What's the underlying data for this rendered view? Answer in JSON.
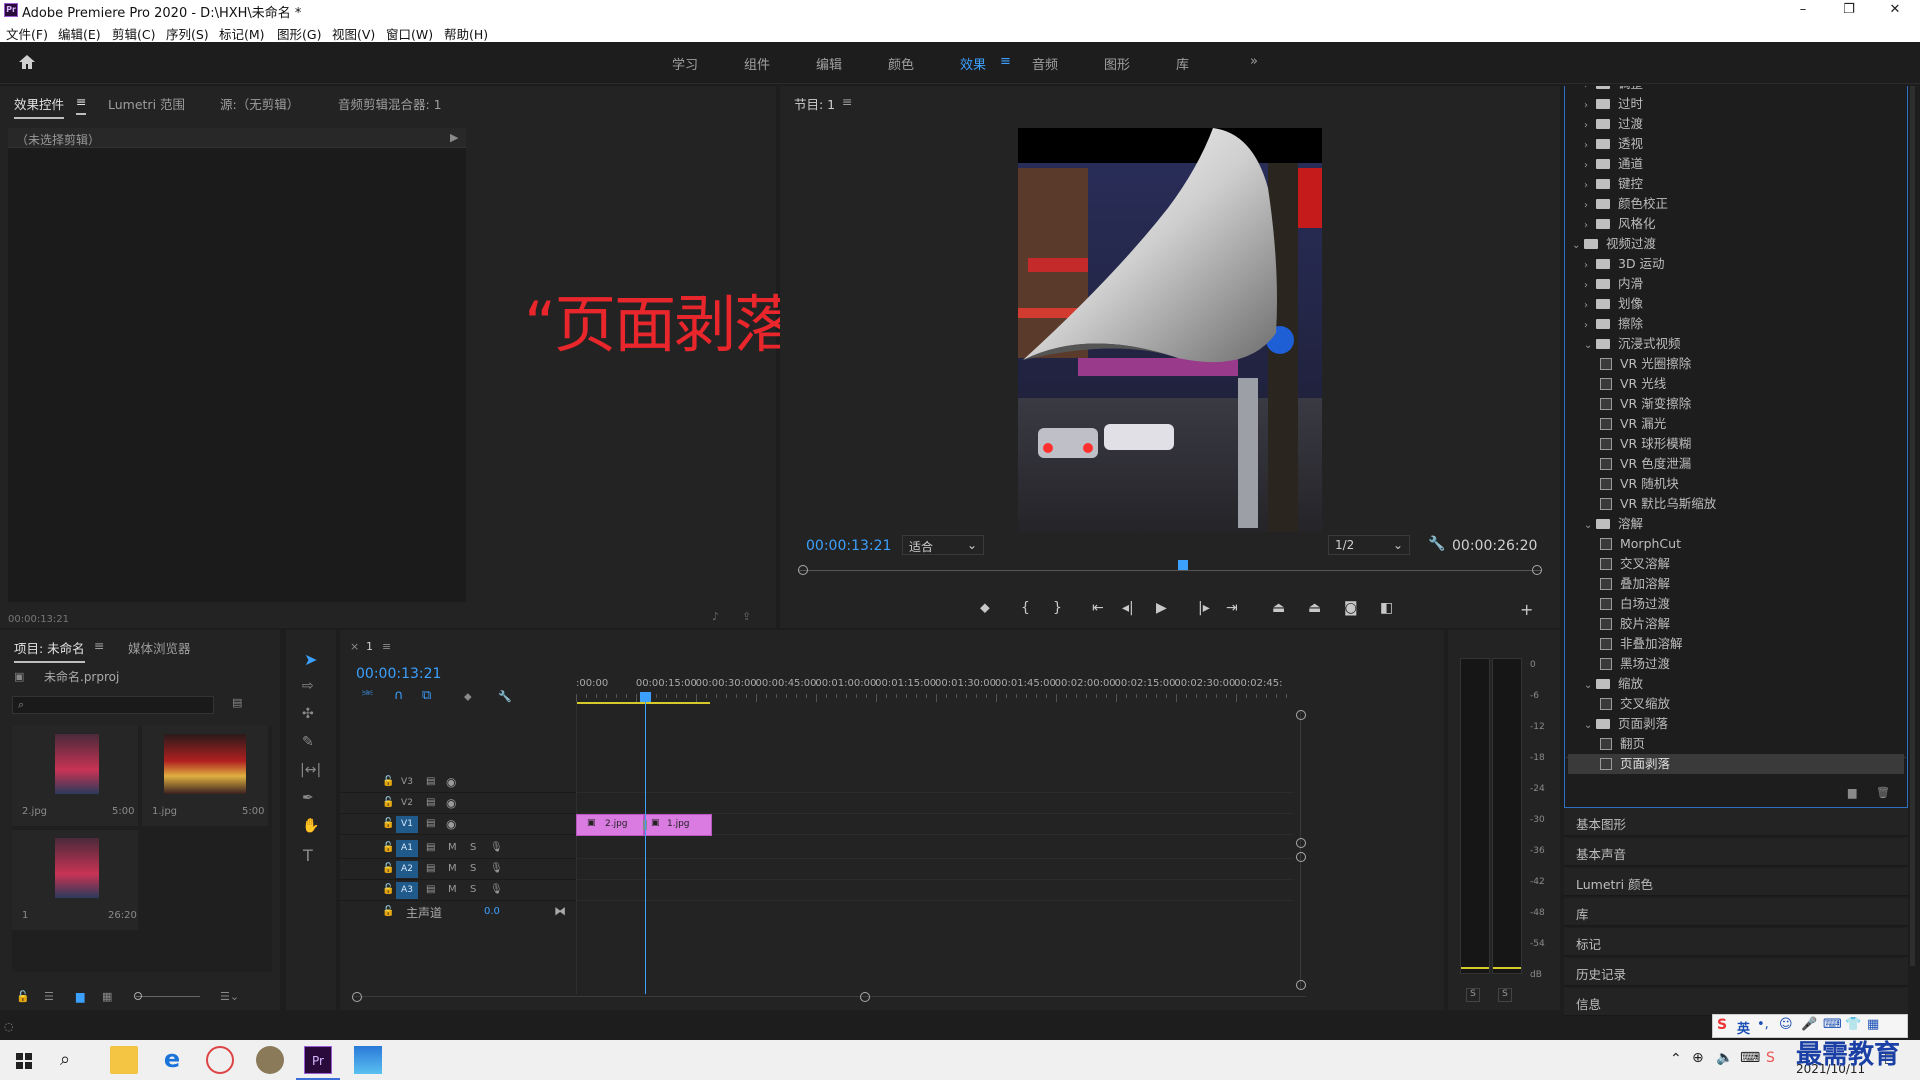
{
  "app": {
    "title": "Adobe Premiere Pro 2020 - D:\\HXH\\未命名 *",
    "logo": "Pr"
  },
  "menu": [
    "文件(F)",
    "编辑(E)",
    "剪辑(C)",
    "序列(S)",
    "标记(M)",
    "图形(G)",
    "视图(V)",
    "窗口(W)",
    "帮助(H)"
  ],
  "workspaces": [
    "学习",
    "组件",
    "编辑",
    "颜色",
    "效果",
    "音频",
    "图形",
    "库"
  ],
  "active_workspace": "效果",
  "source_panel": {
    "tabs": [
      "效果控件",
      "Lumetri 范围",
      "源:（无剪辑）",
      "音频剪辑混合器: 1"
    ],
    "no_clip": "（未选择剪辑）",
    "timecode": "00:00:13:21"
  },
  "program_panel": {
    "tab": "节目: 1",
    "timecode": "00:00:13:21",
    "fit": "适合",
    "resolution": "1/2",
    "duration": "00:00:26:20"
  },
  "overlay_caption": "“页面剥落”效果",
  "project_panel": {
    "tabs": [
      "项目: 未命名",
      "媒体浏览器"
    ],
    "file": "未命名.prproj",
    "items": [
      {
        "name": "2.jpg",
        "dur": "5:00"
      },
      {
        "name": "1.jpg",
        "dur": "5:00"
      },
      {
        "name": "1",
        "dur": "26:20"
      }
    ]
  },
  "timeline": {
    "tab": "1",
    "timecode": "00:00:13:21",
    "ruler": [
      ":00:00",
      "00:00:15:00",
      "00:00:30:00",
      "00:00:45:00",
      "00:01:00:00",
      "00:01:15:00",
      "00:01:30:00",
      "00:01:45:00",
      "00:02:00:00",
      "00:02:15:00",
      "00:02:30:00",
      "00:02:45:"
    ],
    "tracks": [
      "V3",
      "V2",
      "V1",
      "A1",
      "A2",
      "A3"
    ],
    "master": "主声道",
    "master_val": "0.0",
    "clips": [
      "2.jpg",
      "1.jpg"
    ]
  },
  "meter": {
    "scale": [
      "0",
      "-6",
      "-12",
      "-18",
      "-24",
      "-30",
      "-36",
      "-42",
      "-48",
      "-54",
      "dB"
    ],
    "solo": [
      "S",
      "S"
    ]
  },
  "effects_tree": [
    {
      "type": "folder",
      "label": "调整",
      "level": 1,
      "open": false
    },
    {
      "type": "folder",
      "label": "过时",
      "level": 1,
      "open": false
    },
    {
      "type": "folder",
      "label": "过渡",
      "level": 1,
      "open": false
    },
    {
      "type": "folder",
      "label": "透视",
      "level": 1,
      "open": false
    },
    {
      "type": "folder",
      "label": "通道",
      "level": 1,
      "open": false
    },
    {
      "type": "folder",
      "label": "键控",
      "level": 1,
      "open": false
    },
    {
      "type": "folder",
      "label": "颜色校正",
      "level": 1,
      "open": false
    },
    {
      "type": "folder",
      "label": "风格化",
      "level": 1,
      "open": false
    },
    {
      "type": "folder",
      "label": "视频过渡",
      "level": 0,
      "open": true
    },
    {
      "type": "folder",
      "label": "3D 运动",
      "level": 1,
      "open": false
    },
    {
      "type": "folder",
      "label": "内滑",
      "level": 1,
      "open": false
    },
    {
      "type": "folder",
      "label": "划像",
      "level": 1,
      "open": false
    },
    {
      "type": "folder",
      "label": "擦除",
      "level": 1,
      "open": false
    },
    {
      "type": "folder",
      "label": "沉浸式视频",
      "level": 1,
      "open": true
    },
    {
      "type": "fx",
      "label": "VR 光圈擦除",
      "level": 2
    },
    {
      "type": "fx",
      "label": "VR 光线",
      "level": 2
    },
    {
      "type": "fx",
      "label": "VR 渐变擦除",
      "level": 2
    },
    {
      "type": "fx",
      "label": "VR 漏光",
      "level": 2
    },
    {
      "type": "fx",
      "label": "VR 球形模糊",
      "level": 2
    },
    {
      "type": "fx",
      "label": "VR 色度泄漏",
      "level": 2
    },
    {
      "type": "fx",
      "label": "VR 随机块",
      "level": 2
    },
    {
      "type": "fx",
      "label": "VR 默比乌斯缩放",
      "level": 2
    },
    {
      "type": "folder",
      "label": "溶解",
      "level": 1,
      "open": true
    },
    {
      "type": "fx",
      "label": "MorphCut",
      "level": 2
    },
    {
      "type": "fx",
      "label": "交叉溶解",
      "level": 2
    },
    {
      "type": "fx",
      "label": "叠加溶解",
      "level": 2
    },
    {
      "type": "fx",
      "label": "白场过渡",
      "level": 2
    },
    {
      "type": "fx",
      "label": "胶片溶解",
      "level": 2
    },
    {
      "type": "fx",
      "label": "非叠加溶解",
      "level": 2
    },
    {
      "type": "fx",
      "label": "黑场过渡",
      "level": 2
    },
    {
      "type": "folder",
      "label": "缩放",
      "level": 1,
      "open": true
    },
    {
      "type": "fx",
      "label": "交叉缩放",
      "level": 2
    },
    {
      "type": "folder",
      "label": "页面剥落",
      "level": 1,
      "open": true
    },
    {
      "type": "fx",
      "label": "翻页",
      "level": 2
    },
    {
      "type": "fx",
      "label": "页面剥落",
      "level": 2,
      "selected": true
    }
  ],
  "right_panels": [
    "基本图形",
    "基本声音",
    "Lumetri 颜色",
    "库",
    "标记",
    "历史记录",
    "信息"
  ],
  "taskbar": {
    "date": "2021/10/11",
    "ime": "英",
    "watermark": "最需教育"
  }
}
